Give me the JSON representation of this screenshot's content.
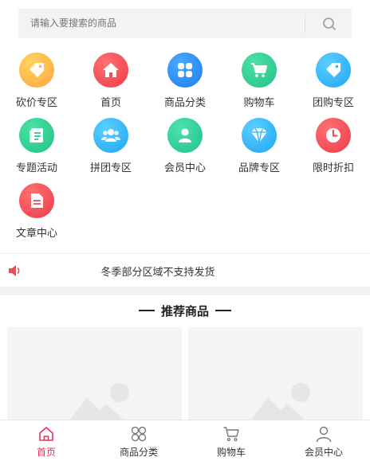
{
  "search": {
    "placeholder": "请输入要搜索的商品"
  },
  "nav_items": [
    {
      "label": "砍价专区",
      "icon": "bargain-tag-icon",
      "color": "#ffb84a"
    },
    {
      "label": "首页",
      "icon": "home-icon",
      "color": "#f24b55"
    },
    {
      "label": "商品分类",
      "icon": "category-grid-icon",
      "color": "#2a8ff6"
    },
    {
      "label": "购物车",
      "icon": "shopping-cart-icon",
      "color": "#27c98c"
    },
    {
      "label": "团购专区",
      "icon": "group-buy-tag-icon",
      "color": "#2bb5f5"
    },
    {
      "label": "专题活动",
      "icon": "topic-doc-icon",
      "color": "#24c98f"
    },
    {
      "label": "拼团专区",
      "icon": "group-people-icon",
      "color": "#2ab4f6"
    },
    {
      "label": "会员中心",
      "icon": "member-user-icon",
      "color": "#2cc99a"
    },
    {
      "label": "品牌专区",
      "icon": "diamond-icon",
      "color": "#2bb4f6"
    },
    {
      "label": "限时折扣",
      "icon": "clock-icon",
      "color": "#f24b55"
    },
    {
      "label": "文章中心",
      "icon": "article-doc-icon",
      "color": "#f24b55"
    }
  ],
  "notice": {
    "text": "冬季部分区域不支持发货",
    "icon": "speaker-icon"
  },
  "recommend": {
    "title": "推荐商品"
  },
  "tabbar": [
    {
      "label": "首页",
      "icon": "home-outline-icon",
      "active": true
    },
    {
      "label": "商品分类",
      "icon": "category-outline-icon",
      "active": false
    },
    {
      "label": "购物车",
      "icon": "cart-outline-icon",
      "active": false
    },
    {
      "label": "会员中心",
      "icon": "user-outline-icon",
      "active": false
    }
  ],
  "colors": {
    "accent": "#e8305a",
    "placeholder_bg": "#f4f4f4"
  }
}
